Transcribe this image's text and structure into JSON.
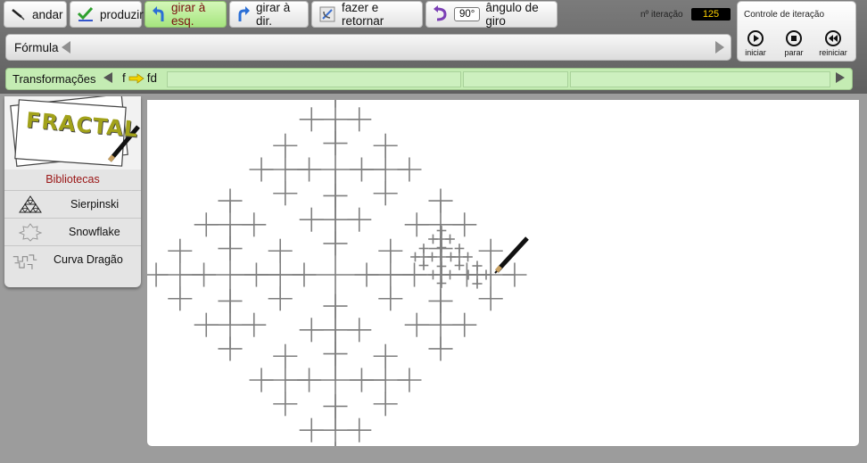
{
  "toolbar": {
    "andar": "andar",
    "produzir": "produzir",
    "girar_esq": "girar à esq.",
    "girar_dir": "girar à dir.",
    "fazer_retornar": "fazer e retornar",
    "angle_value": "90°",
    "angle_label": "ângulo de giro"
  },
  "iteration": {
    "label": "nº iteração",
    "value": "125"
  },
  "iteration_control": {
    "title": "Controle de iteração",
    "start": "iniciar",
    "stop": "parar",
    "reset": "reiniciar"
  },
  "formula": {
    "label": "Fórmula"
  },
  "transformations": {
    "label": "Transformações",
    "rule_from": "f",
    "rule_to": "fd"
  },
  "sidebar": {
    "logo": "FRACTAL",
    "title": "Bibliotecas",
    "items": [
      {
        "label": "Sierpinski",
        "icon": "sierpinski-icon"
      },
      {
        "label": "Snowflake",
        "icon": "snowflake-icon"
      },
      {
        "label": "Curva Dragão",
        "icon": "dragon-curve-icon"
      }
    ]
  },
  "colors": {
    "active_button": "#a6e57f",
    "active_text": "#7a1010",
    "iteration_value": "#ffd200",
    "fractal": "#808080",
    "transform_bar": "#c4ecb3"
  }
}
